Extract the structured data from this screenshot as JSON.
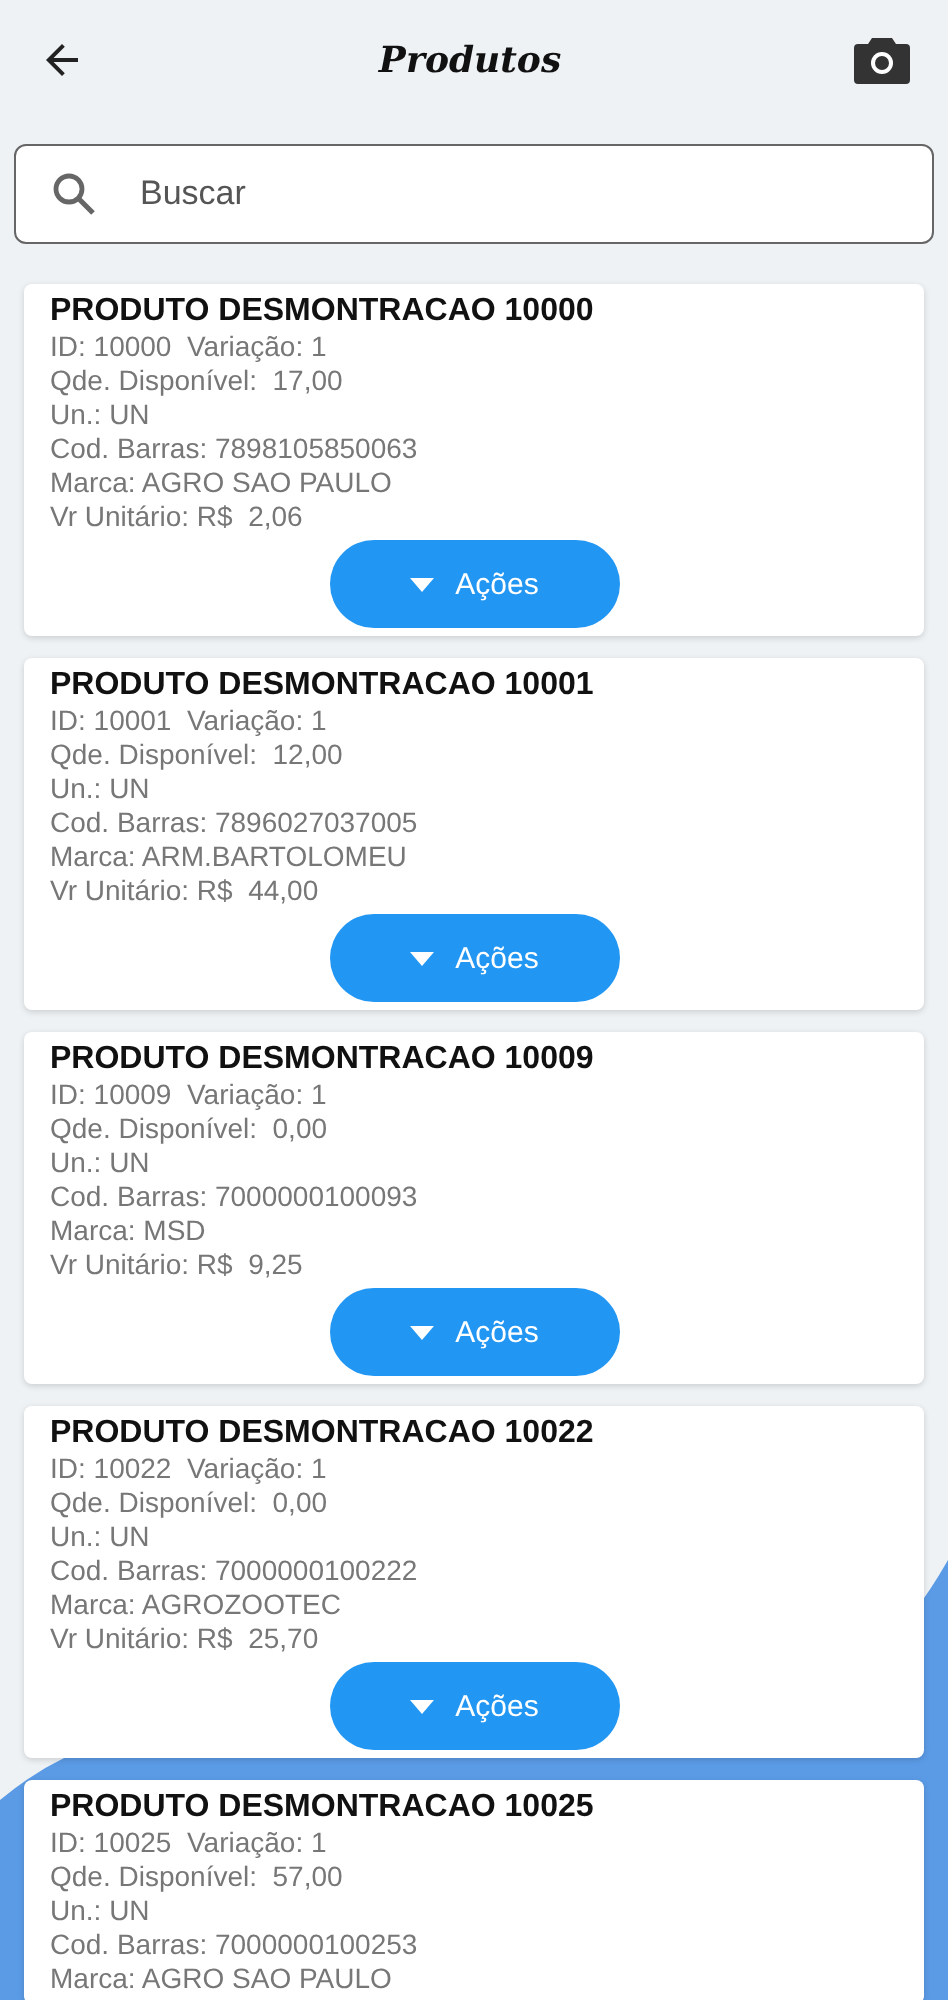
{
  "header": {
    "title": "Produtos"
  },
  "search": {
    "placeholder": "Buscar"
  },
  "products": [
    {
      "name": "PRODUTO DESMONTRACAO 10000",
      "lines": [
        "ID: 10000  Variação: 1",
        "Qde. Disponível:  17,00",
        "Un.: UN",
        "Cod. Barras: 7898105850063",
        "Marca: AGRO SAO PAULO",
        "Vr Unitário: R$  2,06"
      ],
      "action": "Ações"
    },
    {
      "name": "PRODUTO DESMONTRACAO 10001",
      "lines": [
        "ID: 10001  Variação: 1",
        "Qde. Disponível:  12,00",
        "Un.: UN",
        "Cod. Barras: 7896027037005",
        "Marca: ARM.BARTOLOMEU",
        "Vr Unitário: R$  44,00"
      ],
      "action": "Ações"
    },
    {
      "name": "PRODUTO DESMONTRACAO 10009",
      "lines": [
        "ID: 10009  Variação: 1",
        "Qde. Disponível:  0,00",
        "Un.: UN",
        "Cod. Barras: 7000000100093",
        "Marca: MSD",
        "Vr Unitário: R$  9,25"
      ],
      "action": "Ações"
    },
    {
      "name": "PRODUTO DESMONTRACAO 10022",
      "lines": [
        "ID: 10022  Variação: 1",
        "Qde. Disponível:  0,00",
        "Un.: UN",
        "Cod. Barras: 7000000100222",
        "Marca: AGROZOOTEC",
        "Vr Unitário: R$  25,70"
      ],
      "action": "Ações"
    },
    {
      "name": "PRODUTO DESMONTRACAO 10025",
      "lines": [
        "ID: 10025  Variação: 1",
        "Qde. Disponível:  57,00",
        "Un.: UN",
        "Cod. Barras: 7000000100253",
        "Marca: AGRO SAO PAULO"
      ]
    }
  ]
}
